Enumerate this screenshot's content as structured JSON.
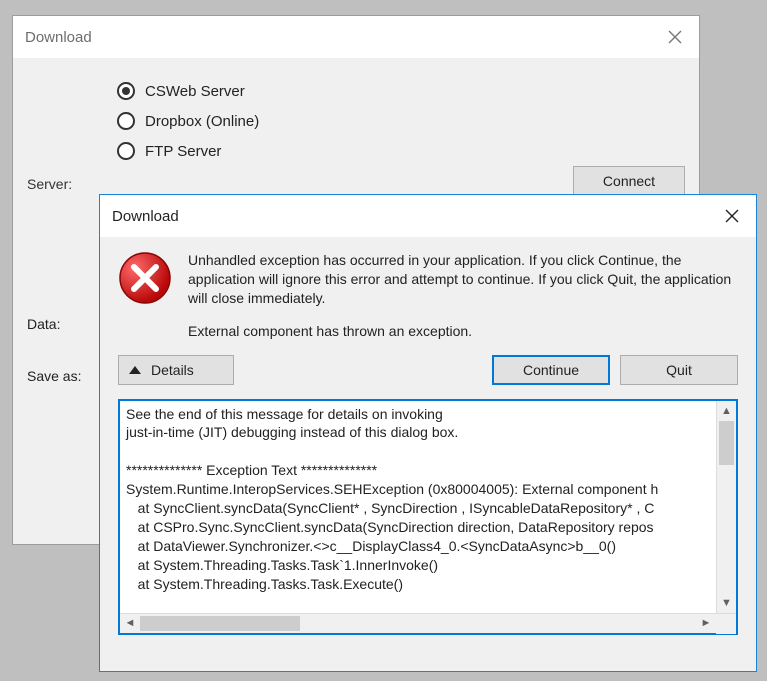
{
  "main_dialog": {
    "title": "Download",
    "server_label": "Server:",
    "radios": {
      "csweb": "CSWeb Server",
      "dropbox": "Dropbox (Online)",
      "ftp": "FTP Server"
    },
    "connect_button": "Connect",
    "data_label": "Data:",
    "save_as_label": "Save as:"
  },
  "error_dialog": {
    "title": "Download",
    "message_main": "Unhandled exception has occurred in your application. If you click Continue, the application will ignore this error and attempt to continue. If you click Quit, the application will close immediately.",
    "message_detail": "External component has thrown an exception.",
    "details_button": "Details",
    "continue_button": "Continue",
    "quit_button": "Quit",
    "details_text": "See the end of this message for details on invoking \njust-in-time (JIT) debugging instead of this dialog box.\n\n************** Exception Text **************\nSystem.Runtime.InteropServices.SEHException (0x80004005): External component h\n   at SyncClient.syncData(SyncClient* , SyncDirection , ISyncableDataRepository* , C\n   at CSPro.Sync.SyncClient.syncData(SyncDirection direction, DataRepository repos\n   at DataViewer.Synchronizer.<>c__DisplayClass4_0.<SyncDataAsync>b__0()\n   at System.Threading.Tasks.Task`1.InnerInvoke()\n   at System.Threading.Tasks.Task.Execute()"
  }
}
